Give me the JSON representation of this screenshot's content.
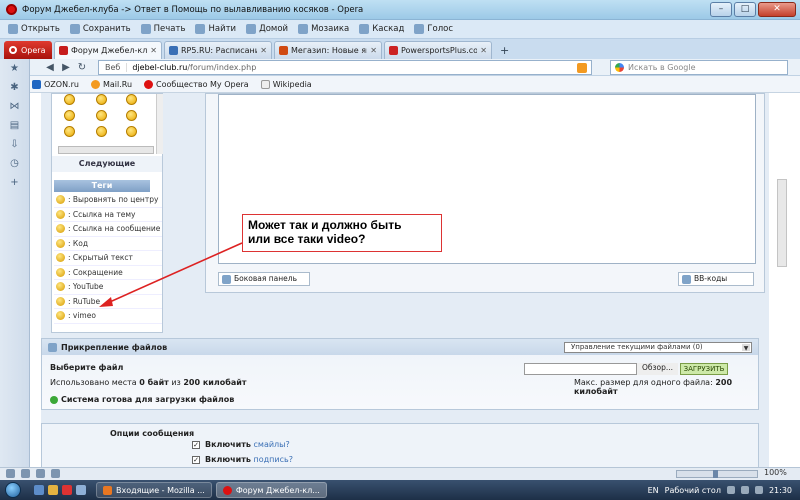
{
  "window": {
    "title": "Форум Джебел-клуба -> Ответ в Помощь по вылавливанию косяков - Opera",
    "buttons": {
      "min": "–",
      "max": "□",
      "close": "✕"
    }
  },
  "menu": [
    "Открыть",
    "Сохранить",
    "Печать",
    "Найти",
    "Домой",
    "Мозаика",
    "Каскад",
    "Голос"
  ],
  "opera_button": "Opera",
  "tabs": [
    {
      "label": "Форум Джебел-клуба...",
      "color": "#c61d1d",
      "active": true
    },
    {
      "label": "RP5.RU: Расписание П...",
      "color": "#3a6fb5",
      "active": false
    },
    {
      "label": "Мегазип: Новые япон...",
      "color": "#d04a12",
      "active": false
    },
    {
      "label": "PowersportsPlus.com ...",
      "color": "#cc2222",
      "active": false
    }
  ],
  "new_tab": "+",
  "address": {
    "web": "Веб",
    "host": "djebel-club.ru",
    "path": "/forum/index.php"
  },
  "search": {
    "placeholder": "Искать в Google"
  },
  "bookmarks": [
    "OZON.ru",
    "Mail.Ru",
    "Сообщество My Opera",
    "Wikipedia"
  ],
  "sidebar": {
    "next_label": "Следующие",
    "tags_title": "Теги",
    "tags": [
      ": Выровнять по центру",
      ": Ссылка на тему",
      ": Ссылка на сообщение",
      ": Код",
      ": Скрытый текст",
      ": Сокращение",
      ": YouTube",
      ": RuTube",
      ": vimeo"
    ]
  },
  "editor": {
    "side_panel_btn": "Боковая панель",
    "bbcode_btn": "BB-коды"
  },
  "annotation": {
    "line1": "Может так и должно быть",
    "line2": "или все таки video?"
  },
  "attachments": {
    "header": "Прикрепление файлов",
    "manage_select": "Управление текущими файлами (0)",
    "choose_file": "Выберите файл",
    "browse": "Обзор...",
    "upload": "ЗАГРУЗИТЬ",
    "used_prefix": "Использовано места",
    "used_value": "0 байт",
    "used_mid": "из",
    "used_total": "200 килобайт",
    "max_prefix": "Макс. размер для одного файла:",
    "max_value": "200 килобайт",
    "ready": "Система готова для загрузки файлов"
  },
  "options": {
    "title": "Опции сообщения",
    "opt1_bold": "Включить",
    "opt1_link": "смайлы?",
    "opt2_bold": "Включить",
    "opt2_link": "подпись?"
  },
  "statusbar": {
    "zoom": "100%"
  },
  "taskbar": {
    "tasks": [
      {
        "label": "Входящие - Mozilla ...",
        "color": "#e87722",
        "active": false
      },
      {
        "label": "Форум Джебел-кл...",
        "color": "#d11",
        "active": true
      }
    ],
    "lang": "EN",
    "desktop": "Рабочий стол",
    "clock": "21:30"
  },
  "colors": {
    "accent": "#3a6fb5",
    "annotation_red": "#dd2222",
    "upload_green": "#cde9a8"
  }
}
